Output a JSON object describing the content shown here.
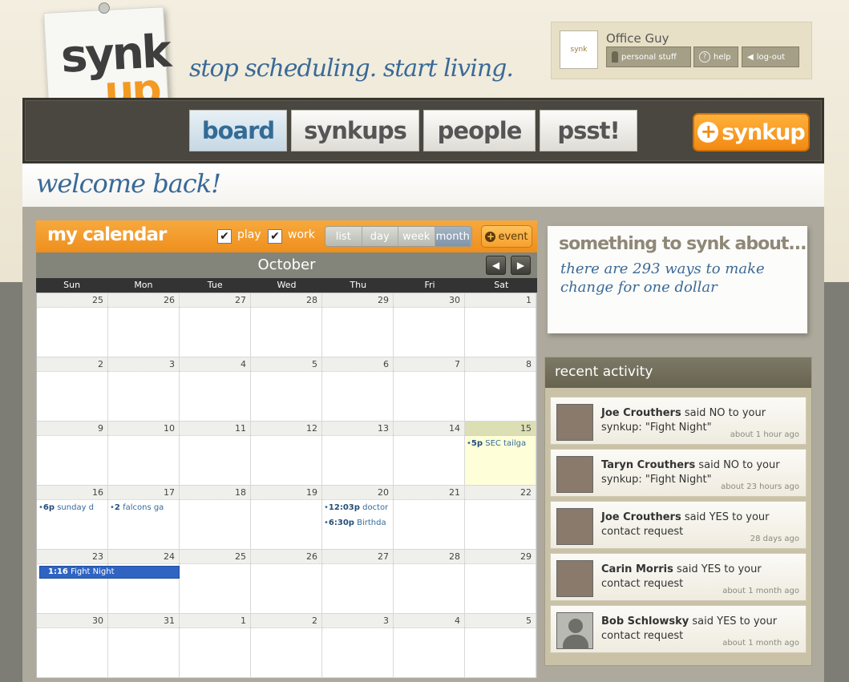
{
  "logo": {
    "line1": "synk",
    "line2": "up"
  },
  "tagline": "stop scheduling. start living.",
  "user": {
    "name": "Office Guy",
    "avatar_text": "synk",
    "buttons": {
      "personal": "personal stuff",
      "help": "help",
      "logout": "log-out"
    }
  },
  "nav": {
    "tabs": [
      {
        "label": "board",
        "active": true
      },
      {
        "label": "synkups",
        "active": false
      },
      {
        "label": "people",
        "active": false
      },
      {
        "label": "psst!",
        "active": false
      }
    ],
    "add_label": "synkup"
  },
  "welcome": "welcome back!",
  "calendar": {
    "title": "my calendar",
    "filters": {
      "play": "play",
      "work": "work"
    },
    "views": [
      "list",
      "day",
      "week",
      "month"
    ],
    "selected_view": "month",
    "event_button": "event",
    "month": "October",
    "days_of_week": [
      "Sun",
      "Mon",
      "Tue",
      "Wed",
      "Thu",
      "Fri",
      "Sat"
    ],
    "weeks": [
      [
        "25",
        "26",
        "27",
        "28",
        "29",
        "30",
        "1"
      ],
      [
        "2",
        "3",
        "4",
        "5",
        "6",
        "7",
        "8"
      ],
      [
        "9",
        "10",
        "11",
        "12",
        "13",
        "14",
        "15"
      ],
      [
        "16",
        "17",
        "18",
        "19",
        "20",
        "21",
        "22"
      ],
      [
        "23",
        "24",
        "25",
        "26",
        "27",
        "28",
        "29"
      ],
      [
        "30",
        "31",
        "1",
        "2",
        "3",
        "4",
        "5"
      ]
    ],
    "events": {
      "sec": {
        "time": "5p",
        "title": "SEC tailga"
      },
      "sunday": {
        "time": "6p",
        "title": "sunday d"
      },
      "falcons": {
        "time": "2",
        "title": "falcons ga"
      },
      "doctor": {
        "time": "12:03p",
        "title": "doctor"
      },
      "birthday": {
        "time": "6:30p",
        "title": "Birthda"
      },
      "fight": {
        "time": "1:16",
        "title": "Fight Night"
      }
    }
  },
  "synk_about": {
    "heading": "something to synk about...",
    "text": "there are 293 ways to make change for one dollar"
  },
  "activity": {
    "title": "recent activity",
    "items": [
      {
        "name": "Joe Crouthers",
        "text": "said NO to your synkup: \"Fight Night\"",
        "when": "about 1 hour ago"
      },
      {
        "name": "Taryn Crouthers",
        "text": "said NO to your synkup: \"Fight Night\"",
        "when": "about 23 hours ago"
      },
      {
        "name": "Joe Crouthers",
        "text": "said YES to your contact request",
        "when": "28 days ago"
      },
      {
        "name": "Carin Morris",
        "text": "said YES to your contact request",
        "when": "about 1 month ago"
      },
      {
        "name": "Bob Schlowsky",
        "text": "said YES to your contact request",
        "when": "about 1 month ago"
      }
    ]
  }
}
